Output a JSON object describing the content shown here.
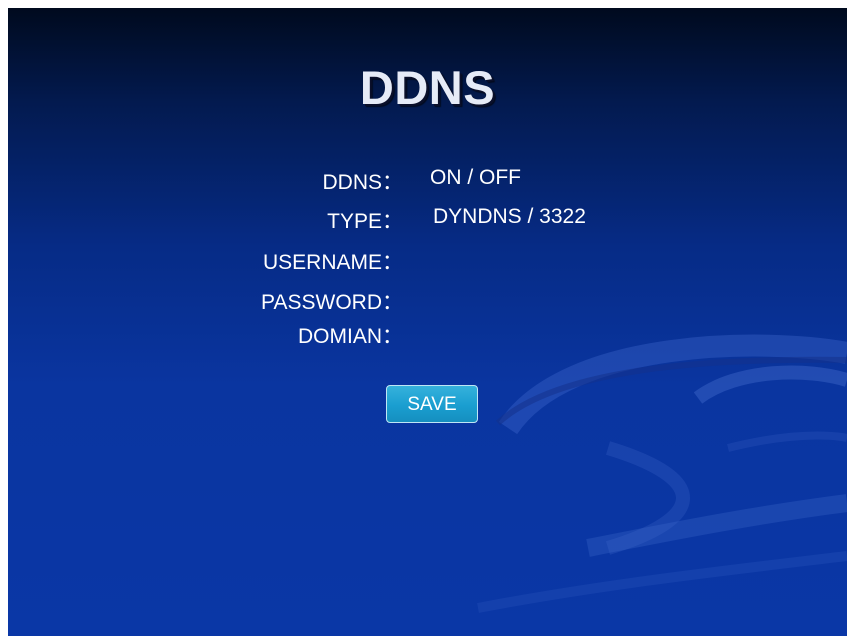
{
  "title": "DDNS",
  "fields": [
    {
      "label": "DDNS：",
      "value": "ON / OFF"
    },
    {
      "label": "TYPE：",
      "value": "DYNDNS / 3322"
    },
    {
      "label": "USERNAME：",
      "value": ""
    },
    {
      "label": "PASSWORD：",
      "value": ""
    },
    {
      "label": "DOMIAN：",
      "value": ""
    }
  ],
  "save_label": "SAVE",
  "colors": {
    "background": "#0a35a0",
    "button": "#1a9ed0",
    "text": "#ffffff"
  }
}
